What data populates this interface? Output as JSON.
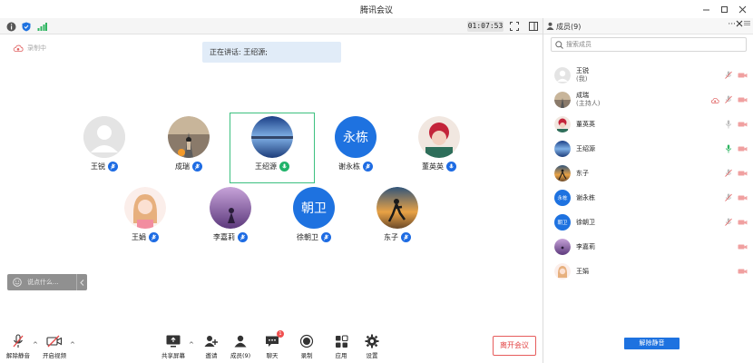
{
  "window": {
    "title": "腾讯会议"
  },
  "status": {
    "timer": "01:07:53"
  },
  "main": {
    "recording_label": "录制中",
    "speaking_text": "正在讲话: 王绍源;",
    "participants": [
      {
        "name": "王锐",
        "avatar": "default"
      },
      {
        "name": "成瑞",
        "avatar": "photo-road"
      },
      {
        "name": "王绍源",
        "avatar": "photo-lake",
        "speaking": true
      },
      {
        "name": "谢永栋",
        "avatar": "text",
        "initials": "永栋"
      },
      {
        "name": "董英英",
        "avatar": "photo-red"
      },
      {
        "name": "王娟",
        "avatar": "photo-girl"
      },
      {
        "name": "李嘉莉",
        "avatar": "photo-purple"
      },
      {
        "name": "徐朝卫",
        "avatar": "text",
        "initials": "朝卫"
      },
      {
        "name": "东子",
        "avatar": "photo-sunset"
      }
    ],
    "chat_placeholder": "说点什么..."
  },
  "toolbar": {
    "unmute": "解除静音",
    "start_video": "开启视频",
    "share_screen": "共享屏幕",
    "invite": "邀请",
    "members": "成员(9)",
    "chat": "聊天",
    "chat_badge": "1",
    "record": "录制",
    "apps": "应用",
    "settings": "设置",
    "leave": "离开会议"
  },
  "panel": {
    "title": "成员(9)",
    "search_placeholder": "搜索成员",
    "members": [
      {
        "name": "王锐",
        "sub": "(我)",
        "mic": "muted",
        "cam": "off"
      },
      {
        "name": "成瑞",
        "sub": "(主持人)",
        "mic": "muted",
        "cam": "off"
      },
      {
        "name": "董英英",
        "sub": "",
        "mic": "on",
        "cam": "off"
      },
      {
        "name": "王绍源",
        "sub": "",
        "mic": "speaking",
        "cam": "off"
      },
      {
        "name": "东子",
        "sub": "",
        "mic": "muted",
        "cam": "off"
      },
      {
        "name": "谢永栋",
        "sub": "",
        "mic": "muted",
        "cam": "off"
      },
      {
        "name": "徐朝卫",
        "sub": "",
        "mic": "muted",
        "cam": "off"
      },
      {
        "name": "李嘉莉",
        "sub": "",
        "mic": "",
        "cam": "off"
      },
      {
        "name": "王娟",
        "sub": "",
        "mic": "",
        "cam": "off"
      }
    ],
    "unmute_all": "解除静音"
  },
  "colors": {
    "accent": "#1e72e0",
    "speaking": "#3cc07f",
    "leave": "#e34545"
  }
}
